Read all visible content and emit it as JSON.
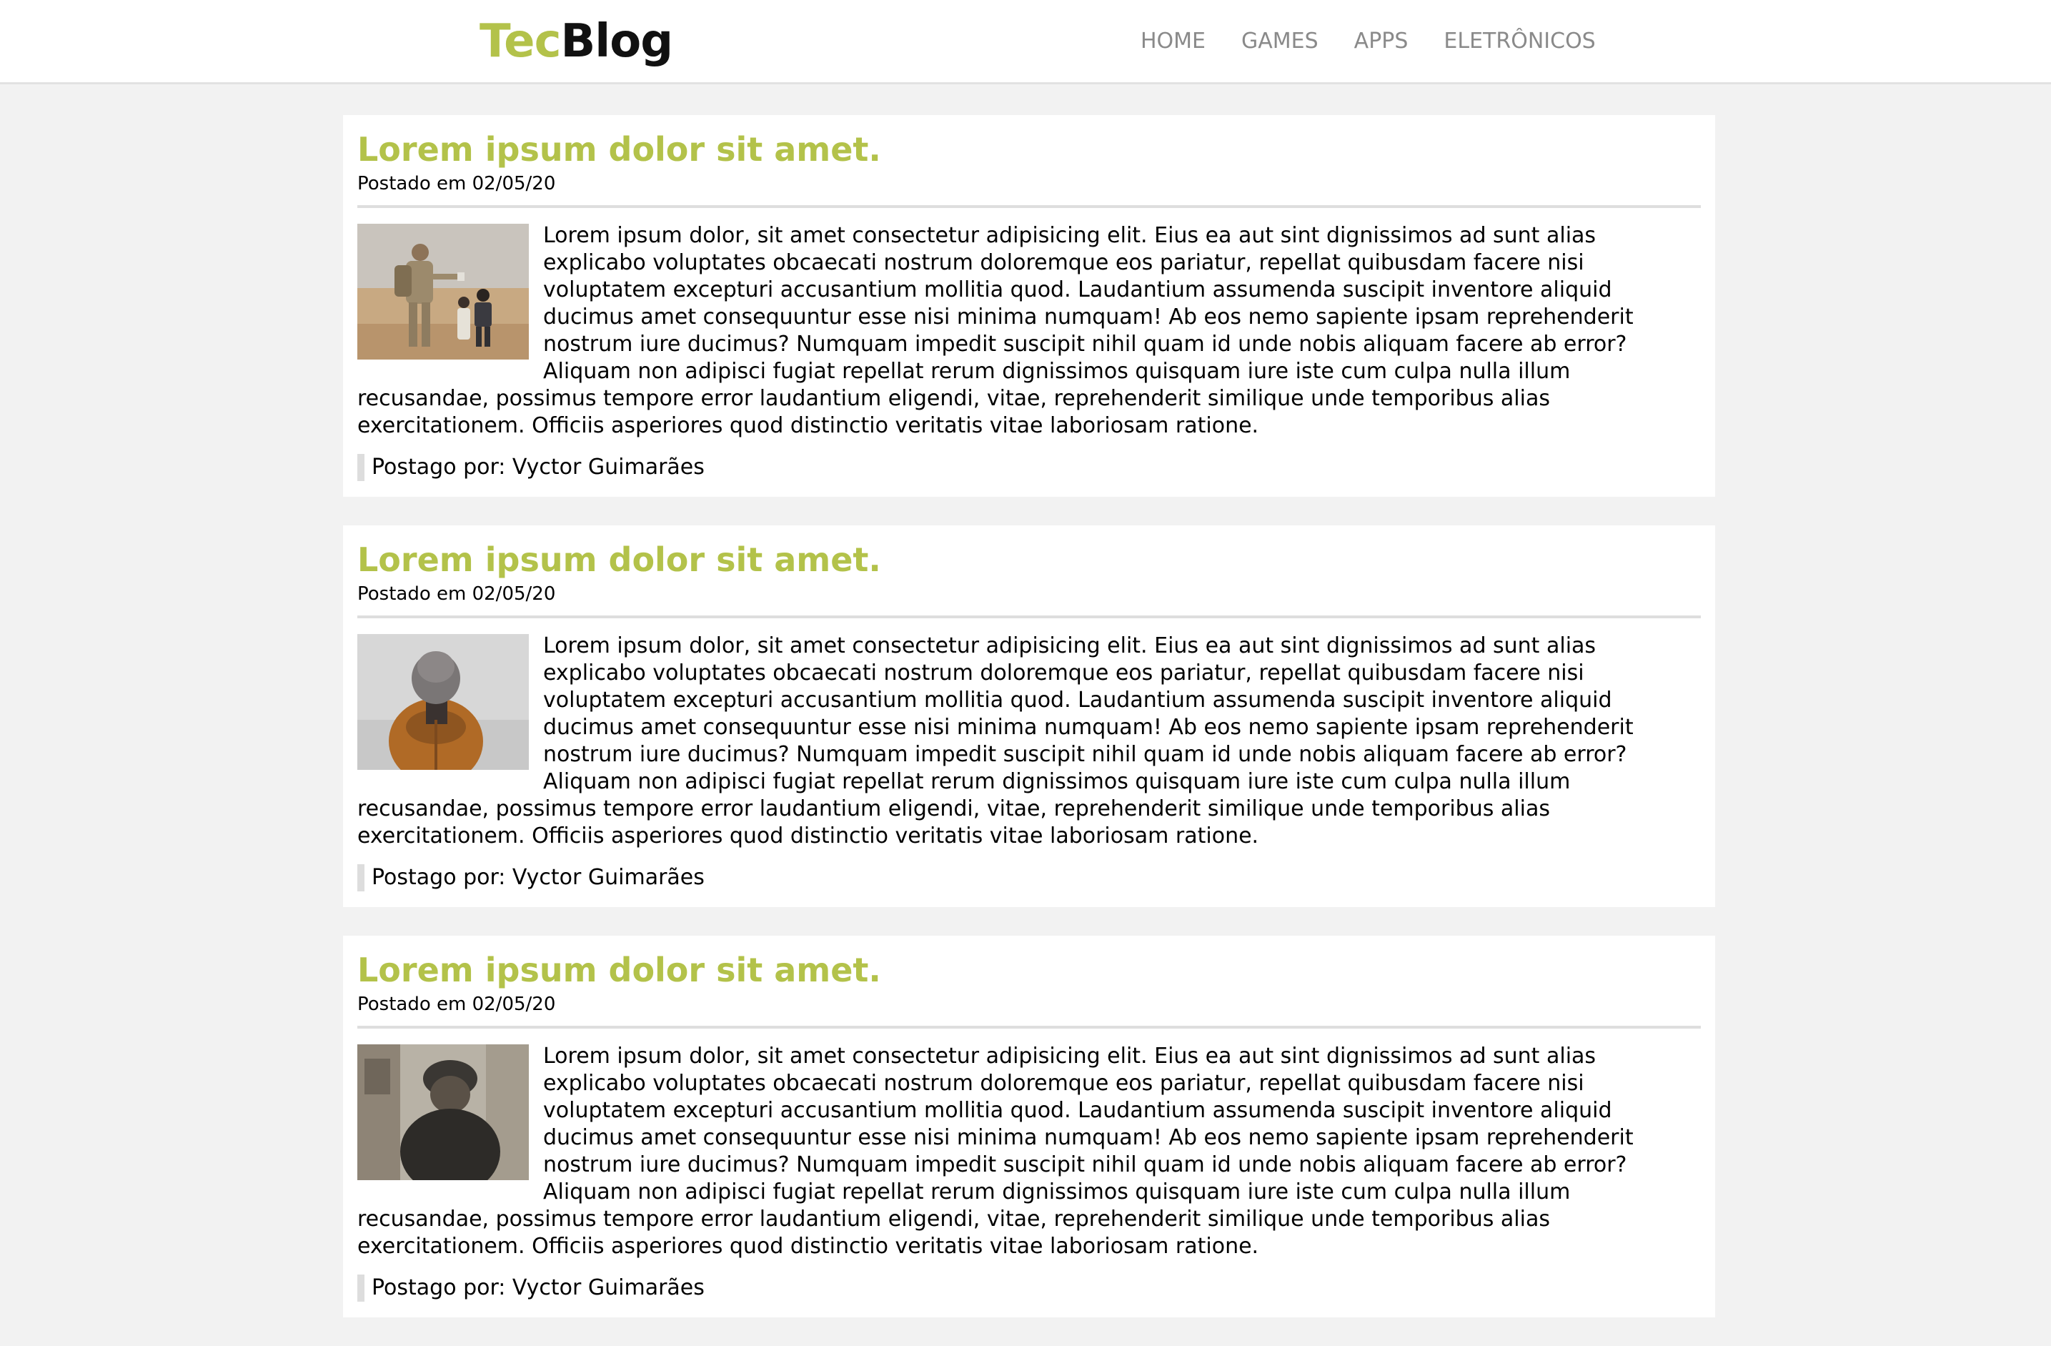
{
  "header": {
    "logo_part1": "Tec",
    "logo_part2": "Blog",
    "nav": [
      "HOME",
      "GAMES",
      "APPS",
      "ELETRÔNICOS"
    ]
  },
  "posts": [
    {
      "title": "Lorem ipsum dolor sit amet.",
      "date": "Postado em 02/05/20",
      "image": "soldier-child-photo",
      "body": "Lorem ipsum dolor, sit amet consectetur adipisicing elit. Eius ea aut sint dignissimos ad sunt alias explicabo voluptates obcaecati nostrum doloremque eos pariatur, repellat quibusdam facere nisi voluptatem excepturi accusantium mollitia quod. Laudantium assumenda suscipit inventore aliquid ducimus amet consequuntur esse nisi minima numquam! Ab eos nemo sapiente ipsam reprehenderit nostrum iure ducimus? Numquam impedit suscipit nihil quam id unde nobis aliquam facere ab error? Aliquam non adipisci fugiat repellat rerum dignissimos quisquam iure iste cum culpa nulla illum recusandae, possimus tempore error laudantium eligendi, vitae, reprehenderit similique unde temporibus alias exercitationem. Officiis asperiores quod distinctio veritatis vitae laboriosam ratione.",
      "author": "Postago por: Vyctor Guimarães"
    },
    {
      "title": "Lorem ipsum dolor sit amet.",
      "date": "Postado em 02/05/20",
      "image": "person-beanie-photo",
      "body": "Lorem ipsum dolor, sit amet consectetur adipisicing elit. Eius ea aut sint dignissimos ad sunt alias explicabo voluptates obcaecati nostrum doloremque eos pariatur, repellat quibusdam facere nisi voluptatem excepturi accusantium mollitia quod. Laudantium assumenda suscipit inventore aliquid ducimus amet consequuntur esse nisi minima numquam! Ab eos nemo sapiente ipsam reprehenderit nostrum iure ducimus? Numquam impedit suscipit nihil quam id unde nobis aliquam facere ab error? Aliquam non adipisci fugiat repellat rerum dignissimos quisquam iure iste cum culpa nulla illum recusandae, possimus tempore error laudantium eligendi, vitae, reprehenderit similique unde temporibus alias exercitationem. Officiis asperiores quod distinctio veritatis vitae laboriosam ratione.",
      "author": "Postago por: Vyctor Guimarães"
    },
    {
      "title": "Lorem ipsum dolor sit amet.",
      "date": "Postado em 02/05/20",
      "image": "old-man-photo",
      "body": "Lorem ipsum dolor, sit amet consectetur adipisicing elit. Eius ea aut sint dignissimos ad sunt alias explicabo voluptates obcaecati nostrum doloremque eos pariatur, repellat quibusdam facere nisi voluptatem excepturi accusantium mollitia quod. Laudantium assumenda suscipit inventore aliquid ducimus amet consequuntur esse nisi minima numquam! Ab eos nemo sapiente ipsam reprehenderit nostrum iure ducimus? Numquam impedit suscipit nihil quam id unde nobis aliquam facere ab error? Aliquam non adipisci fugiat repellat rerum dignissimos quisquam iure iste cum culpa nulla illum recusandae, possimus tempore error laudantium eligendi, vitae, reprehenderit similique unde temporibus alias exercitationem. Officiis asperiores quod distinctio veritatis vitae laboriosam ratione.",
      "author": "Postago por: Vyctor Guimarães"
    }
  ],
  "colors": {
    "accent": "#b3c24a",
    "page_bg": "#f2f2f2",
    "nav_text": "#8a8a8a"
  }
}
